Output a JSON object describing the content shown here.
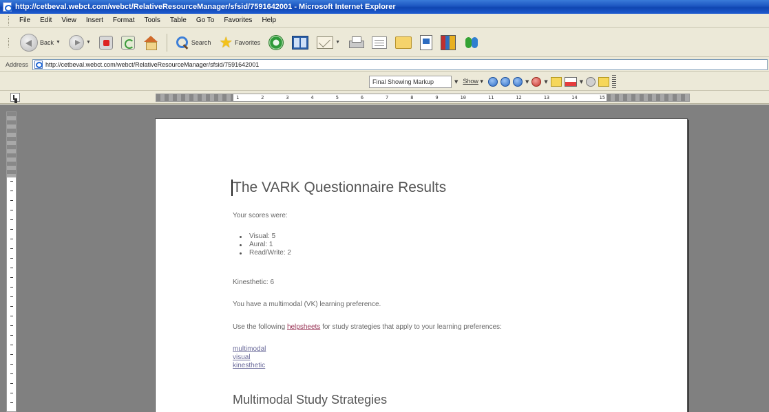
{
  "window": {
    "title": "http://cetbeval.webct.com/webct/RelativeResourceManager/sfsid/7591642001 - Microsoft Internet Explorer"
  },
  "menu": {
    "items": [
      {
        "label": "File"
      },
      {
        "label": "Edit"
      },
      {
        "label": "View"
      },
      {
        "label": "Insert"
      },
      {
        "label": "Format"
      },
      {
        "label": "Tools"
      },
      {
        "label": "Table"
      },
      {
        "label": "Go To"
      },
      {
        "label": "Favorites"
      },
      {
        "label": "Help"
      }
    ]
  },
  "toolbar": {
    "back_label": "Back",
    "search_label": "Search",
    "favorites_label": "Favorites"
  },
  "address": {
    "label": "Address",
    "url": "http://cetbeval.webct.com/webct/RelativeResourceManager/sfsid/7591642001"
  },
  "reviewing": {
    "display_mode": "Final Showing Markup",
    "show_label": "Show"
  },
  "ruler": {
    "numbers": [
      "1",
      "2",
      "3",
      "4",
      "5",
      "6",
      "7",
      "8",
      "9",
      "10",
      "11",
      "12",
      "13",
      "14",
      "15"
    ]
  },
  "document": {
    "heading": "The VARK Questionnaire Results",
    "scores_intro": "Your scores were:",
    "scores": [
      {
        "text": "Visual: 5"
      },
      {
        "text": "Aural: 1"
      },
      {
        "text": "Read/Write: 2"
      }
    ],
    "kinesthetic": "Kinesthetic: 6",
    "preference": "You have a multimodal (VK) learning preference.",
    "helpsheets_before": "Use the following ",
    "helpsheets_link": "helpsheets",
    "helpsheets_after": " for study strategies that apply to your learning preferences:",
    "links": [
      {
        "text": "multimodal"
      },
      {
        "text": "visual"
      },
      {
        "text": "kinesthetic"
      }
    ],
    "section_heading": "Multimodal Study Strategies"
  }
}
